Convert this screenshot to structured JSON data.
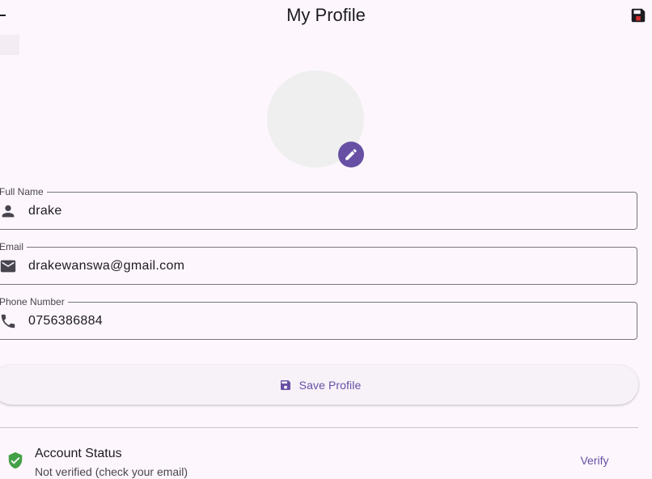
{
  "app_bar": {
    "title": "My Profile",
    "back_icon": "back-arrow-icon",
    "action_icon": "save-floppy-icon"
  },
  "avatar": {
    "edit_icon": "pencil-edit-icon"
  },
  "fields": {
    "full_name": {
      "label": "Full Name",
      "value": "drake",
      "icon": "person-icon"
    },
    "email": {
      "label": "Email",
      "value": "drakewanswa@gmail.com",
      "icon": "mail-icon"
    },
    "phone": {
      "label": "Phone Number",
      "value": "0756386884",
      "icon": "phone-icon"
    }
  },
  "save_button": {
    "label": "Save Profile",
    "icon": "save-floppy-icon"
  },
  "account_status": {
    "title": "Account Status",
    "subtitle": "Not verified (check your email)",
    "action_label": "Verify",
    "icon": "verified-shield-icon"
  },
  "colors": {
    "background": "#fdf7fd",
    "primary": "#6750a4",
    "avatar_placeholder": "#efefef",
    "status_green": "#43a047",
    "save_icon_red": "#d32f2f"
  }
}
